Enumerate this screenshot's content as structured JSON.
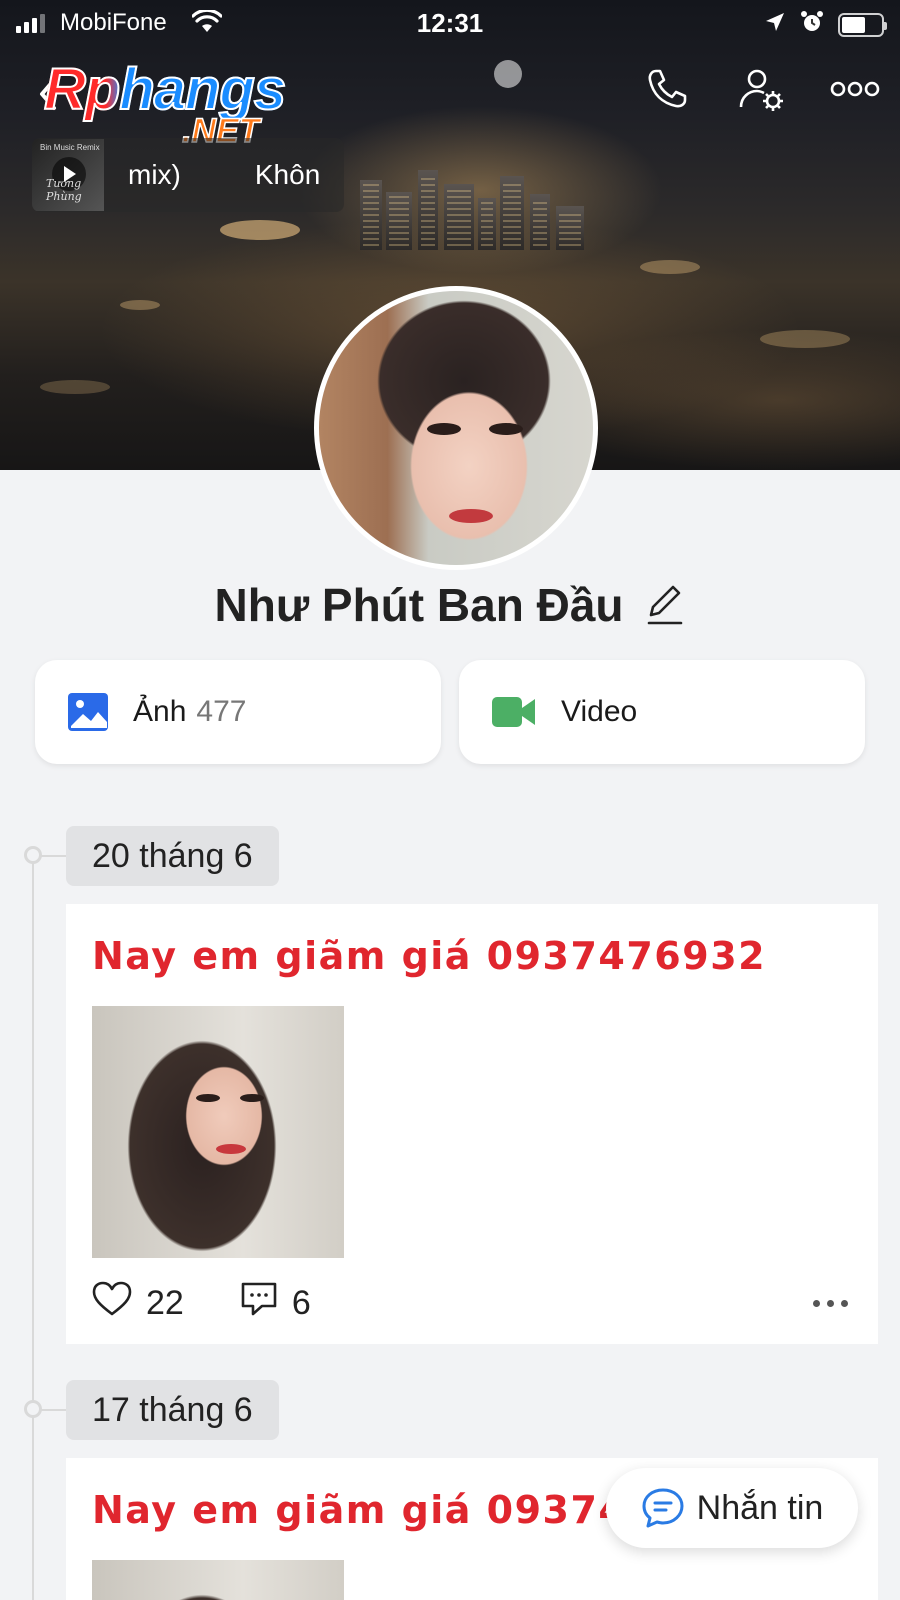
{
  "status_bar": {
    "carrier": "MobiFone",
    "time": "12:31"
  },
  "header": {
    "logo_main": "Rphangs",
    "logo_sub": ".NET"
  },
  "music": {
    "thumb_caption": "Bin Music Remix",
    "thumb_script": "Tương Phùng",
    "marquee_a": "mix)",
    "marquee_b": "Khôn"
  },
  "profile": {
    "name": "Như Phút Ban Đầu"
  },
  "media": {
    "photos_label": "Ảnh",
    "photos_count": "477",
    "video_label": "Video"
  },
  "timeline": [
    {
      "date": "20 tháng 6",
      "text": "Nay em giãm giá 0937476932",
      "likes": "22",
      "comments": "6"
    },
    {
      "date": "17 tháng 6",
      "text": "Nay em giãm giá 0937476"
    }
  ],
  "fab": {
    "label": "Nhắn tin"
  },
  "colors": {
    "accent_red": "#e0262e",
    "photo_blue": "#2a6ae8",
    "video_green": "#4caf65",
    "message_blue": "#2a7be4"
  }
}
